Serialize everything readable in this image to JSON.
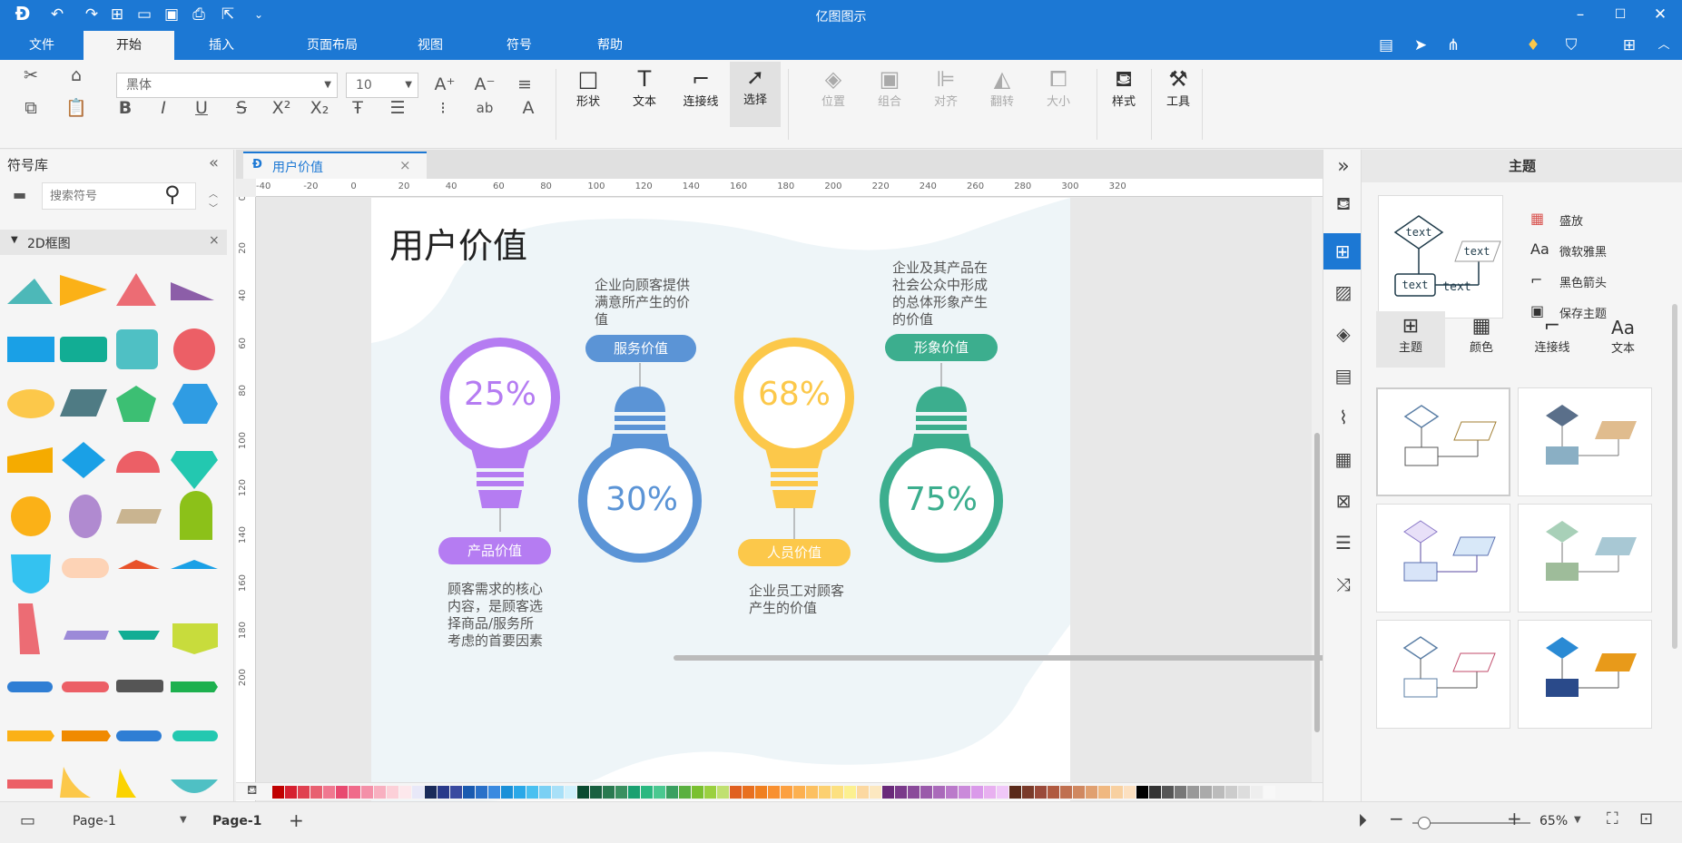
{
  "app": {
    "title": "亿图图示"
  },
  "menu": [
    "文件",
    "开始",
    "插入",
    "页面布局",
    "视图",
    "符号",
    "帮助"
  ],
  "ribbon": {
    "font_name": "黑体",
    "font_size": "10",
    "shape": "形状",
    "text": "文本",
    "connector": "连接线",
    "select": "选择",
    "position": "位置",
    "group": "组合",
    "align": "对齐",
    "flip": "翻转",
    "size": "大小",
    "style": "样式",
    "tools": "工具"
  },
  "left": {
    "title": "符号库",
    "search_placeholder": "搜索符号",
    "category": "2D框图"
  },
  "tab": {
    "name": "用户价值"
  },
  "ruler": {
    "h": [
      "-40",
      "-20",
      "0",
      "20",
      "40",
      "60",
      "80",
      "100",
      "120",
      "140",
      "160",
      "180",
      "200",
      "220",
      "240",
      "260",
      "280",
      "300",
      "320"
    ],
    "v": [
      "0",
      "20",
      "40",
      "60",
      "80",
      "100",
      "120",
      "140",
      "160",
      "180",
      "200"
    ]
  },
  "canvas": {
    "title": "用户价值",
    "bulbs": [
      {
        "pct": "25%",
        "label": "产品价值",
        "desc": "顾客需求的核心内容，是顾客选择商品/服务所考虑的首要因素",
        "color": "#b57cf2"
      },
      {
        "pct": "30%",
        "label": "服务价值",
        "desc": "企业向顾客提供满意所产生的价值",
        "color": "#5b94d6"
      },
      {
        "pct": "68%",
        "label": "人员价值",
        "desc": "企业员工对顾客产生的价值",
        "color": "#fcc84a"
      },
      {
        "pct": "75%",
        "label": "形象价值",
        "desc": "企业及其产品在社会公众中形成的总体形象产生的价值",
        "color": "#3cae8e"
      }
    ],
    "desc_lines": {
      "d1": [
        "顾客需求的核心",
        "内容，是顾客选",
        "择商品/服务所",
        "考虑的首要因素"
      ],
      "d2": [
        "企业向顾客提供",
        "满意所产生的价",
        "值"
      ],
      "d3": [
        "企业员工对顾客",
        "产生的价值"
      ],
      "d4": [
        "企业及其产品在",
        "社会公众中形成",
        "的总体形象产生",
        "的价值"
      ]
    }
  },
  "right": {
    "title": "主题",
    "opts": [
      "盛放",
      "微软雅黑",
      "黑色箭头",
      "保存主题"
    ],
    "tabs": [
      "主题",
      "颜色",
      "连接线",
      "文本"
    ],
    "preview_text": "text"
  },
  "status": {
    "page_select": "Page-1",
    "page_tab": "Page-1",
    "zoom": "65%"
  }
}
